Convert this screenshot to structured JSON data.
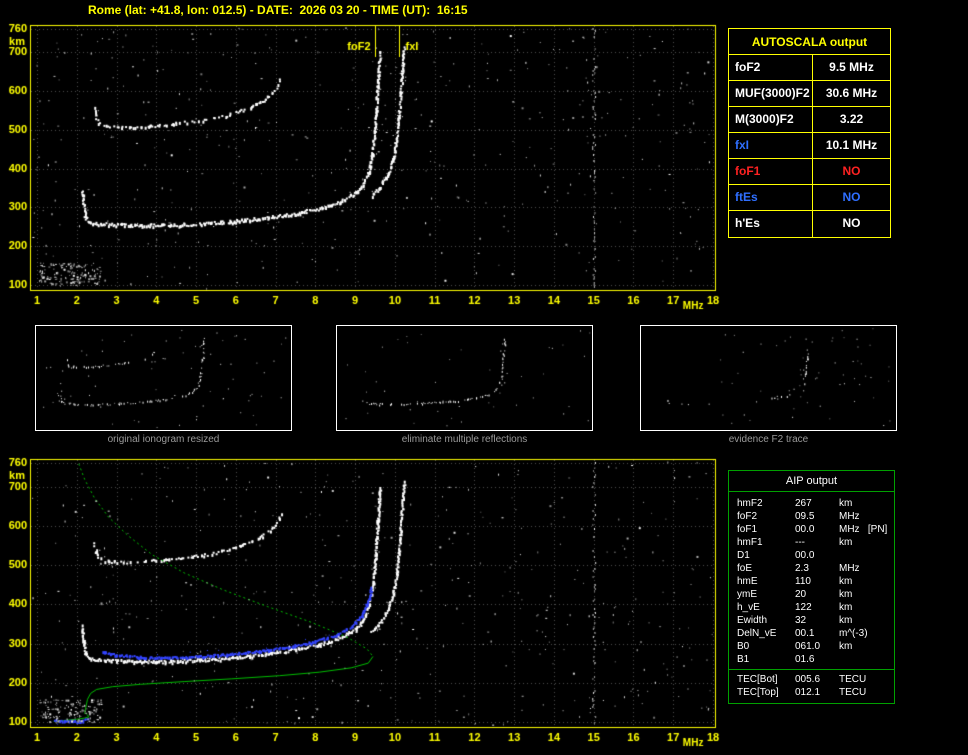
{
  "title": "Rome (lat: +41.8, lon: 012.5) - DATE:  2026 03 20 - TIME (UT):  16:15",
  "colors": {
    "background": "#000000",
    "axis": "#ffff00",
    "grid": "#4f4f4f",
    "trace_white": "#ffffff",
    "trace_blue": "#3344ff",
    "profile_green": "#00c000",
    "autoscala_border": "#ffff00",
    "aip_border": "#00a000",
    "caption_gray": "#9a9a9a",
    "text_red": "#ff2222",
    "text_blue": "#2f6fff",
    "text_white": "#ffffff"
  },
  "autoscala": {
    "header": "AUTOSCALA output",
    "rows": [
      {
        "label": "foF2",
        "value": "9.5 MHz",
        "label_color": "#ffffff",
        "value_color": "#ffffff"
      },
      {
        "label": "MUF(3000)F2",
        "value": "30.6 MHz",
        "label_color": "#ffffff",
        "value_color": "#ffffff"
      },
      {
        "label": "M(3000)F2",
        "value": "3.22",
        "label_color": "#ffffff",
        "value_color": "#ffffff"
      },
      {
        "label": "fxI",
        "value": "10.1 MHz",
        "label_color": "#2f6fff",
        "value_color": "#ffffff"
      },
      {
        "label": "foF1",
        "value": "NO",
        "label_color": "#ff2222",
        "value_color": "#ff2222"
      },
      {
        "label": "ftEs",
        "value": "NO",
        "label_color": "#2f6fff",
        "value_color": "#2f6fff"
      },
      {
        "label": "h'Es",
        "value": "NO",
        "label_color": "#ffffff",
        "value_color": "#ffffff"
      }
    ]
  },
  "thumbnails": {
    "captions": [
      "original ionogram resized",
      "eliminate multiple reflections",
      "evidence F2 trace"
    ],
    "xlim": [
      1,
      14
    ],
    "ylim": [
      100,
      760
    ],
    "panels": [
      {
        "seed": 101,
        "noise": 70,
        "series": [
          {
            "ref": 0,
            "density": 0.5
          },
          {
            "ref": 2,
            "density": 0.35
          }
        ]
      },
      {
        "seed": 102,
        "noise": 42,
        "series": [
          {
            "ref": 0,
            "density": 0.5
          }
        ]
      },
      {
        "seed": 103,
        "noise": 60,
        "noise_bias": "right",
        "series": [
          {
            "ref": 0,
            "density": 0.07
          },
          {
            "points": [
              [
                7.6,
                295
              ],
              [
                8.2,
                315
              ],
              [
                8.7,
                340
              ],
              [
                9.05,
                372
              ],
              [
                9.3,
                420
              ],
              [
                9.42,
                480
              ],
              [
                9.5,
                550
              ],
              [
                9.55,
                620
              ]
            ],
            "density": 0.35
          }
        ]
      }
    ]
  },
  "aip": {
    "header": "AIP output",
    "rows": [
      {
        "name": "hmF2",
        "value": "267",
        "unit": "km"
      },
      {
        "name": "foF2",
        "value": "09.5",
        "unit": "MHz"
      },
      {
        "name": "foF1",
        "value": "00.0",
        "unit": "MHz   [PN]"
      },
      {
        "name": "hmF1",
        "value": "---",
        "unit": "km"
      },
      {
        "name": "D1",
        "value": "00.0",
        "unit": ""
      },
      {
        "name": "foE",
        "value": "2.3",
        "unit": "MHz"
      },
      {
        "name": "hmE",
        "value": "110",
        "unit": "km"
      },
      {
        "name": "ymE",
        "value": "20",
        "unit": "km"
      },
      {
        "name": "h_vE",
        "value": "122",
        "unit": "km"
      },
      {
        "name": "Ewidth",
        "value": "32",
        "unit": "km"
      },
      {
        "name": "DelN_vE",
        "value": "00.1",
        "unit": "m^(-3)"
      },
      {
        "name": "B0",
        "value": "061.0",
        "unit": "km"
      },
      {
        "name": "B1",
        "value": "01.6",
        "unit": ""
      }
    ],
    "tec_rows": [
      {
        "name": "TEC[Bot]",
        "value": "005.6",
        "unit": "TECU"
      },
      {
        "name": "TEC[Top]",
        "value": "012.1",
        "unit": "TECU"
      }
    ]
  },
  "chart_data": [
    {
      "id": "autoscala_ionogram",
      "type": "scatter",
      "title": "",
      "xlabel": "MHz",
      "ylabel": "km",
      "xlim": [
        1,
        18
      ],
      "ylim": [
        100,
        760
      ],
      "xticks": [
        1,
        2,
        3,
        4,
        5,
        6,
        7,
        8,
        9,
        10,
        11,
        12,
        13,
        14,
        15,
        16,
        17,
        18
      ],
      "yticks": [
        100,
        200,
        300,
        400,
        500,
        600,
        700,
        760
      ],
      "grid": true,
      "frame_color": "#ffff00",
      "markers": [
        {
          "label": "foF2",
          "freq_mhz": 9.5,
          "label_side": "left"
        },
        {
          "label": "fxI",
          "freq_mhz": 10.1,
          "label_side": "right"
        }
      ],
      "series": [
        {
          "name": "F trace o-mode",
          "style": "speckle",
          "color": "#ffffff",
          "density": 0.9,
          "size": 2,
          "spread": 1.6,
          "points": [
            [
              2.13,
              345
            ],
            [
              2.16,
              310
            ],
            [
              2.2,
              278
            ],
            [
              2.3,
              264
            ],
            [
              2.6,
              259
            ],
            [
              3.0,
              257
            ],
            [
              3.6,
              255
            ],
            [
              4.4,
              256
            ],
            [
              5.2,
              260
            ],
            [
              6.0,
              266
            ],
            [
              6.8,
              275
            ],
            [
              7.5,
              286
            ],
            [
              8.1,
              299
            ],
            [
              8.6,
              315
            ],
            [
              9.0,
              338
            ],
            [
              9.2,
              362
            ],
            [
              9.33,
              395
            ],
            [
              9.42,
              440
            ],
            [
              9.48,
              495
            ],
            [
              9.52,
              555
            ],
            [
              9.56,
              615
            ],
            [
              9.59,
              668
            ],
            [
              9.61,
              702
            ]
          ]
        },
        {
          "name": "F trace x-mode",
          "style": "speckle",
          "color": "#ffffff",
          "density": 0.85,
          "size": 2,
          "spread": 1.3,
          "points": [
            [
              9.4,
              332
            ],
            [
              9.62,
              355
            ],
            [
              9.82,
              388
            ],
            [
              9.95,
              430
            ],
            [
              10.03,
              480
            ],
            [
              10.09,
              535
            ],
            [
              10.13,
              590
            ],
            [
              10.17,
              645
            ],
            [
              10.2,
              695
            ],
            [
              10.22,
              712
            ]
          ]
        },
        {
          "name": "F trace second hop",
          "style": "speckle",
          "color": "#ffffff",
          "density": 0.5,
          "size": 2,
          "spread": 1.4,
          "points": [
            [
              2.42,
              560
            ],
            [
              2.47,
              535
            ],
            [
              2.55,
              519
            ],
            [
              2.75,
              512
            ],
            [
              3.1,
              508
            ],
            [
              3.6,
              510
            ],
            [
              4.2,
              515
            ],
            [
              4.9,
              523
            ],
            [
              5.5,
              533
            ],
            [
              6.0,
              546
            ],
            [
              6.4,
              561
            ],
            [
              6.75,
              581
            ],
            [
              7.0,
              605
            ],
            [
              7.12,
              632
            ]
          ]
        }
      ],
      "noise": {
        "random_dots": 430,
        "vertical_line_mhz": 15,
        "vertical_density": 0.42,
        "bottom_left_patch": {
          "f": [
            1.05,
            2.6
          ],
          "km": [
            100,
            158
          ],
          "count": 150
        }
      }
    },
    {
      "id": "aip_ionogram",
      "type": "scatter",
      "title": "",
      "xlabel": "MHz",
      "ylabel": "km",
      "xlim": [
        1,
        18
      ],
      "ylim": [
        100,
        760
      ],
      "xticks": [
        1,
        2,
        3,
        4,
        5,
        6,
        7,
        8,
        9,
        10,
        11,
        12,
        13,
        14,
        15,
        16,
        17,
        18
      ],
      "yticks": [
        100,
        200,
        300,
        400,
        500,
        600,
        700,
        760
      ],
      "grid": true,
      "frame_color": "#ffff00",
      "markers": [],
      "series": [
        {
          "name": "F trace o-mode",
          "style": "speckle",
          "color": "#ffffff",
          "density": 0.9,
          "size": 2,
          "spread": 1.6,
          "points": [
            [
              2.13,
              345
            ],
            [
              2.16,
              310
            ],
            [
              2.2,
              278
            ],
            [
              2.3,
              264
            ],
            [
              2.6,
              259
            ],
            [
              3.0,
              257
            ],
            [
              3.6,
              255
            ],
            [
              4.4,
              256
            ],
            [
              5.2,
              260
            ],
            [
              6.0,
              266
            ],
            [
              6.8,
              275
            ],
            [
              7.5,
              286
            ],
            [
              8.1,
              299
            ],
            [
              8.6,
              315
            ],
            [
              9.0,
              338
            ],
            [
              9.2,
              362
            ],
            [
              9.33,
              395
            ],
            [
              9.42,
              440
            ],
            [
              9.48,
              495
            ],
            [
              9.52,
              555
            ],
            [
              9.56,
              615
            ],
            [
              9.59,
              668
            ],
            [
              9.61,
              702
            ]
          ]
        },
        {
          "name": "F trace x-mode",
          "style": "speckle",
          "color": "#ffffff",
          "density": 0.85,
          "size": 2,
          "spread": 1.3,
          "points": [
            [
              9.4,
              332
            ],
            [
              9.62,
              355
            ],
            [
              9.82,
              388
            ],
            [
              9.95,
              430
            ],
            [
              10.03,
              480
            ],
            [
              10.09,
              535
            ],
            [
              10.13,
              590
            ],
            [
              10.17,
              645
            ],
            [
              10.2,
              695
            ],
            [
              10.22,
              712
            ]
          ]
        },
        {
          "name": "F trace second hop",
          "style": "speckle",
          "color": "#ffffff",
          "density": 0.45,
          "size": 2,
          "spread": 1.4,
          "points": [
            [
              2.42,
              560
            ],
            [
              2.47,
              535
            ],
            [
              2.55,
              519
            ],
            [
              2.75,
              512
            ],
            [
              3.1,
              508
            ],
            [
              3.6,
              510
            ],
            [
              4.2,
              515
            ],
            [
              4.9,
              523
            ],
            [
              5.5,
              533
            ],
            [
              6.0,
              546
            ],
            [
              6.4,
              561
            ],
            [
              6.75,
              581
            ],
            [
              7.0,
              605
            ],
            [
              7.12,
              632
            ]
          ]
        },
        {
          "name": "N(h) profile topside",
          "style": "line_dashed",
          "color": "#00c000",
          "points": [
            [
              2.05,
              758
            ],
            [
              2.2,
              718
            ],
            [
              2.45,
              670
            ],
            [
              2.8,
              622
            ],
            [
              3.3,
              574
            ],
            [
              3.9,
              526
            ],
            [
              4.7,
              480
            ],
            [
              5.7,
              436
            ],
            [
              6.8,
              394
            ],
            [
              7.9,
              354
            ],
            [
              8.8,
              316
            ],
            [
              9.3,
              286
            ],
            [
              9.45,
              267
            ]
          ]
        },
        {
          "name": "N(h) profile bottomside",
          "style": "line",
          "color": "#00c000",
          "points": [
            [
              9.45,
              267
            ],
            [
              9.33,
              250
            ],
            [
              8.9,
              238
            ],
            [
              8.1,
              227
            ],
            [
              7.1,
              218
            ],
            [
              5.9,
              210
            ],
            [
              4.7,
              203
            ],
            [
              3.6,
              196
            ],
            [
              2.9,
              190
            ],
            [
              2.5,
              183
            ],
            [
              2.35,
              173
            ],
            [
              2.27,
              158
            ],
            [
              2.24,
              143
            ],
            [
              2.21,
              128
            ],
            [
              2.2,
              121
            ]
          ]
        },
        {
          "name": "N(h) profile E region",
          "style": "line",
          "color": "#00c000",
          "points": [
            [
              1.42,
              101
            ],
            [
              1.7,
              104
            ],
            [
              2.0,
              107
            ],
            [
              2.2,
              110
            ],
            [
              2.3,
              113
            ],
            [
              2.27,
              118
            ],
            [
              2.23,
              122
            ]
          ]
        },
        {
          "name": "restored F2 trace",
          "style": "speckle",
          "color": "#3344ff",
          "density": 0.95,
          "size": 2,
          "spread": 1.0,
          "points": [
            [
              2.6,
              281
            ],
            [
              3.0,
              272
            ],
            [
              3.6,
              267
            ],
            [
              4.2,
              265
            ],
            [
              5.0,
              268
            ],
            [
              5.8,
              274
            ],
            [
              6.6,
              282
            ],
            [
              7.3,
              293
            ],
            [
              7.9,
              305
            ],
            [
              8.5,
              322
            ],
            [
              8.9,
              345
            ],
            [
              9.15,
              372
            ],
            [
              9.3,
              405
            ],
            [
              9.4,
              445
            ]
          ]
        },
        {
          "name": "restored E trace",
          "style": "speckle",
          "color": "#3344ff",
          "density": 0.9,
          "size": 2,
          "spread": 0.8,
          "points": [
            [
              1.45,
              107
            ],
            [
              1.75,
              104
            ],
            [
              2.05,
              104
            ],
            [
              2.25,
              108
            ]
          ]
        }
      ],
      "noise": {
        "random_dots": 430,
        "vertical_line_mhz": 15,
        "vertical_density": 0.42,
        "bottom_left_patch": {
          "f": [
            1.05,
            2.6
          ],
          "km": [
            100,
            158
          ],
          "count": 140
        }
      }
    }
  ]
}
